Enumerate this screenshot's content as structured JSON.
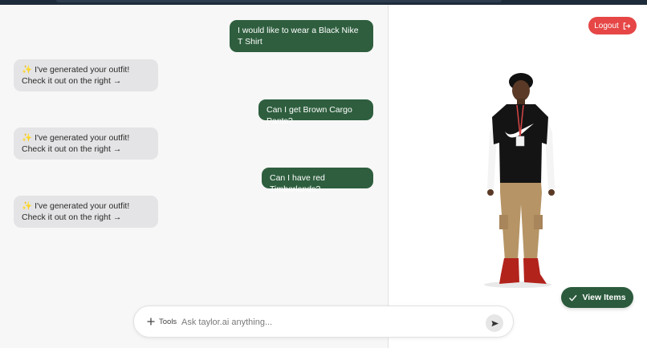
{
  "colors": {
    "user_bubble": "#2e5e3e",
    "bot_bubble": "#e4e4e6",
    "logout": "#e64646",
    "view_items": "#2b5a3c"
  },
  "header": {
    "logout_label": "Logout",
    "logout_icon": "logout-icon"
  },
  "chat": {
    "messages": [
      {
        "role": "user",
        "text": "I would like to wear a Black Nike T Shirt"
      },
      {
        "role": "assistant",
        "icon": "sparkle-icon",
        "text": "I've generated your outfit! Check it out on the right →"
      },
      {
        "role": "user",
        "text": "Can I get Brown Cargo Pants?"
      },
      {
        "role": "assistant",
        "icon": "sparkle-icon",
        "text": "I've generated your outfit! Check it out on the right →"
      },
      {
        "role": "user",
        "text": "Can I have red Timberlands?"
      },
      {
        "role": "assistant",
        "icon": "sparkle-icon",
        "text": "I've generated your outfit! Check it out on the right →"
      }
    ]
  },
  "preview": {
    "view_items_label": "View Items",
    "view_items_icon": "check-icon"
  },
  "composer": {
    "tools_label": "Tools",
    "placeholder": "Ask taylor.ai anything...",
    "value": ""
  }
}
